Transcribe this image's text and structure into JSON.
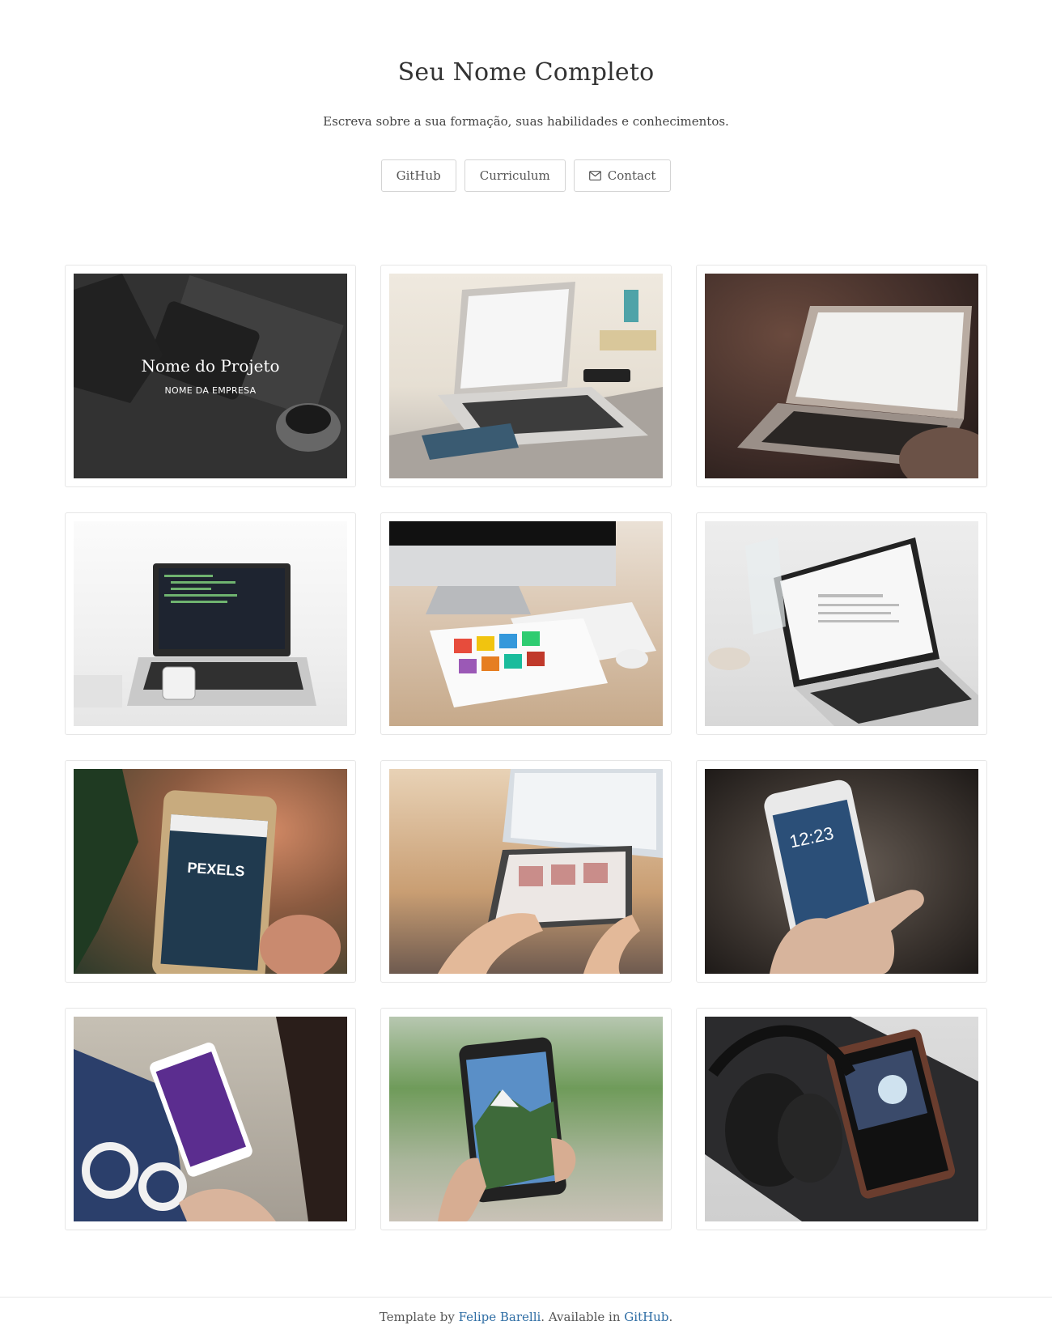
{
  "header": {
    "title": "Seu Nome Completo",
    "subtitle": "Escreva sobre a sua formação, suas habilidades e conhecimentos."
  },
  "buttons": {
    "github": "GitHub",
    "curriculum": "Curriculum",
    "contact": "Contact"
  },
  "projects": [
    {
      "title": "Nome do Projeto",
      "company": "NOME DA EMPRESA"
    }
  ],
  "footer": {
    "prefix": "Template by ",
    "author": "Felipe Barelli",
    "middle": ". Available in ",
    "link": "GitHub",
    "suffix": "."
  }
}
